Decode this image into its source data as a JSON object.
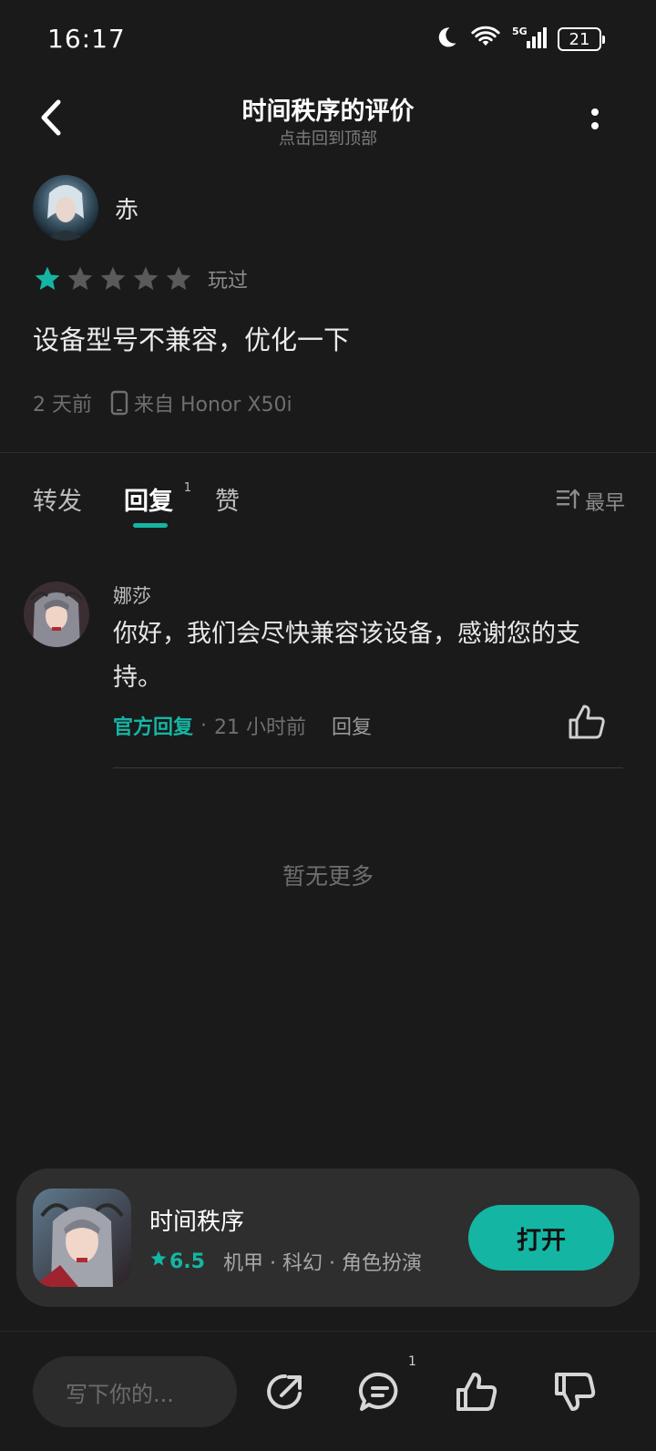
{
  "status_bar": {
    "time": "16:17",
    "battery": "21"
  },
  "header": {
    "title": "时间秩序的评价",
    "subtitle": "点击回到顶部"
  },
  "review": {
    "author": "赤",
    "rating": 1,
    "rating_max": 5,
    "played_label": "玩过",
    "text": "设备型号不兼容，优化一下",
    "time_ago": "2 天前",
    "device": "来自 Honor X50i"
  },
  "tabs": [
    {
      "label": "转发"
    },
    {
      "label": "回复",
      "count": "1"
    },
    {
      "label": "赞"
    }
  ],
  "sort_label": "最早",
  "reply": {
    "author": "娜莎",
    "text": "你好，我们会尽快兼容该设备，感谢您的支持。",
    "official_label": "官方回复",
    "separator": "·",
    "time_ago": "21 小时前",
    "reply_label": "回复"
  },
  "no_more_text": "暂无更多",
  "game_card": {
    "name": "时间秩序",
    "score": "6.5",
    "tags": "机甲 · 科幻 · 角色扮演",
    "open_label": "打开"
  },
  "bottom_bar": {
    "input_placeholder": "写下你的...",
    "comment_count": "1"
  },
  "colors": {
    "accent": "#15b5a3",
    "background": "#1a1a1a",
    "card": "#2e2e2e"
  },
  "icons": [
    "back-arrow-icon",
    "more-vertical-icon",
    "star-icon",
    "phone-icon",
    "sort-icon",
    "thumbs-up-icon",
    "share-icon",
    "comment-icon",
    "thumbs-down-icon",
    "moon-icon",
    "wifi-icon",
    "signal-icon",
    "battery-icon"
  ]
}
